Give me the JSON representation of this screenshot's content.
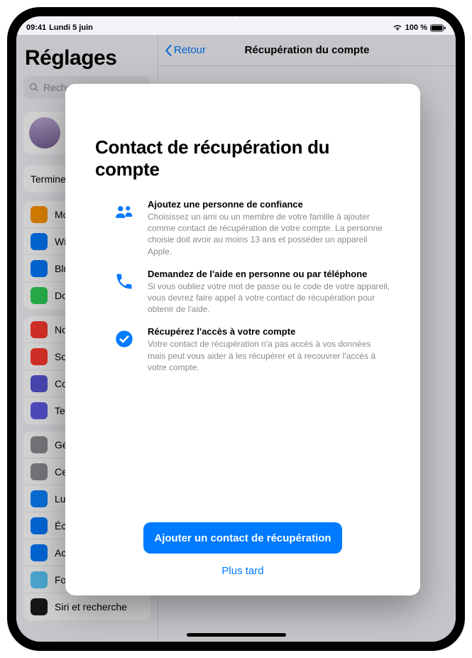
{
  "status": {
    "time": "09:41",
    "date": "Lundi 5 juin",
    "battery_text": "100 %"
  },
  "sidebar": {
    "title": "Réglages",
    "search_placeholder": "Rechercher",
    "single_row": "Terminer la configuration",
    "groups": [
      {
        "items": [
          {
            "label": "Mode Avion",
            "color": "ic-orange"
          },
          {
            "label": "Wi-Fi",
            "color": "ic-blue"
          },
          {
            "label": "Bluetooth",
            "color": "ic-blue"
          },
          {
            "label": "Données cellulaires",
            "color": "ic-green"
          }
        ]
      },
      {
        "items": [
          {
            "label": "Notifications",
            "color": "ic-red"
          },
          {
            "label": "Sons",
            "color": "ic-red"
          },
          {
            "label": "Concentration",
            "color": "ic-purple"
          },
          {
            "label": "Temps d'écran",
            "color": "ic-indigo"
          }
        ]
      },
      {
        "items": [
          {
            "label": "Général",
            "color": "ic-grey"
          },
          {
            "label": "Centre de contrôle",
            "color": "ic-grey"
          },
          {
            "label": "Luminosité",
            "color": "ic-blue2"
          },
          {
            "label": "Écran d'accueil",
            "color": "ic-blue"
          },
          {
            "label": "Accessibilité",
            "color": "ic-blue"
          },
          {
            "label": "Fond d'écran",
            "color": "ic-teal"
          },
          {
            "label": "Siri et recherche",
            "color": "ic-dark"
          }
        ]
      }
    ]
  },
  "detail": {
    "back_label": "Retour",
    "title": "Récupération du compte"
  },
  "sheet": {
    "title": "Contact de récupération du compte",
    "features": [
      {
        "heading": "Ajoutez une personne de confiance",
        "body": "Choisissez un ami ou un membre de votre famille à ajouter comme contact de récupération de votre compte. La personne choisie doit avoir au moins 13 ans et posséder un appareil Apple."
      },
      {
        "heading": "Demandez de l'aide en personne ou par téléphone",
        "body": "Si vous oubliez votre mot de passe ou le code de votre appareil, vous devrez faire appel à votre contact de récupération pour obtenir de l'aide."
      },
      {
        "heading": "Récupérez l'accès à votre compte",
        "body": "Votre contact de récupération n'a pas accès à vos données mais peut vous aider à les récupérer et à recouvrer l'accès à votre compte."
      }
    ],
    "primary_button": "Ajouter un contact de récupération",
    "secondary_link": "Plus tard"
  }
}
